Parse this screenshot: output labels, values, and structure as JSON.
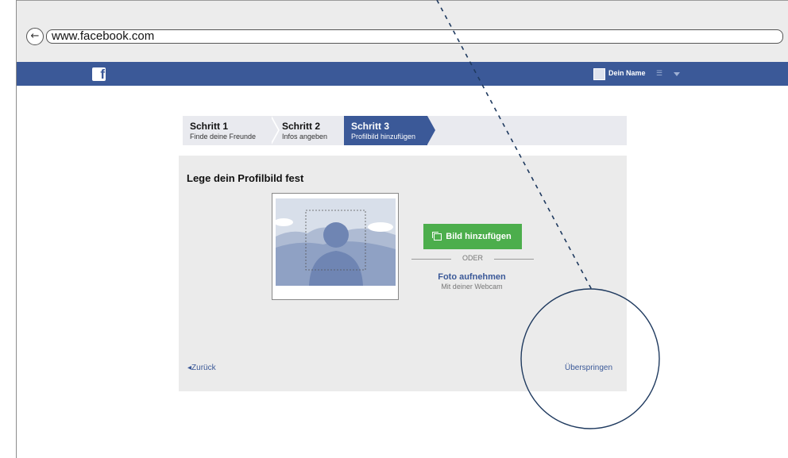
{
  "browser": {
    "url": "www.facebook.com",
    "back_icon": "back-arrow-icon",
    "back_glyph": "←"
  },
  "fb_header": {
    "logo": "f",
    "user_name": "Dein Name",
    "friends_icon_glyph": "☰",
    "brand_color": "#3b5998"
  },
  "steps": [
    {
      "title": "Schritt 1",
      "subtitle": "Finde deine Freunde",
      "active": false
    },
    {
      "title": "Schritt 2",
      "subtitle": "Infos angeben",
      "active": false
    },
    {
      "title": "Schritt 3",
      "subtitle": "Profilbild hinzufügen",
      "active": true
    }
  ],
  "main": {
    "title": "Lege dein Profilbild fest",
    "add_button": "Bild hinzufügen",
    "add_button_color": "#4cae4c",
    "or_label": "ODER",
    "webcam_link": "Foto aufnehmen",
    "webcam_sub": "Mit deiner Webcam",
    "back_link": "Zurück",
    "back_glyph": "◂",
    "skip_link": "Überspringen"
  }
}
